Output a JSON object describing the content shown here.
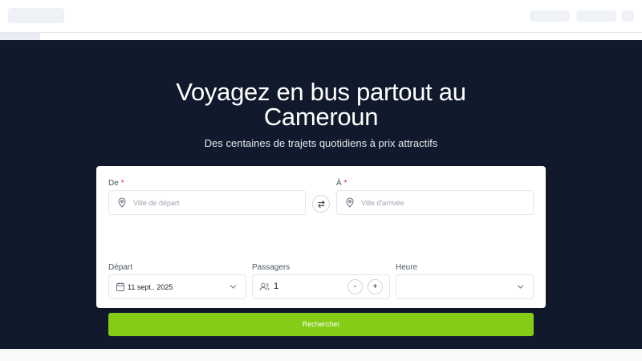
{
  "hero": {
    "title": "Voyagez en bus partout au Cameroun",
    "subtitle": "Des centaines de trajets quotidiens à prix attractifs"
  },
  "search_form": {
    "from": {
      "label": "De",
      "required_mark": "*",
      "placeholder": "Ville de départ",
      "icon": "map-pin-icon"
    },
    "to": {
      "label": "À",
      "required_mark": "*",
      "placeholder": "Ville d'arrivée",
      "icon": "map-pin-icon"
    },
    "swap_icon": "swap-arrows-icon",
    "departure": {
      "label": "Départ",
      "value": "11 sept.. 2025",
      "icon": "calendar-icon"
    },
    "passengers": {
      "label": "Passagers",
      "value": "1",
      "decrement": "-",
      "increment": "+",
      "icon": "users-icon"
    },
    "time": {
      "label": "Heure",
      "value": ""
    },
    "submit_label": "Rechercher"
  },
  "colors": {
    "hero_bg": "#111a2c",
    "accent": "#84cc16",
    "required": "#e11d48"
  }
}
